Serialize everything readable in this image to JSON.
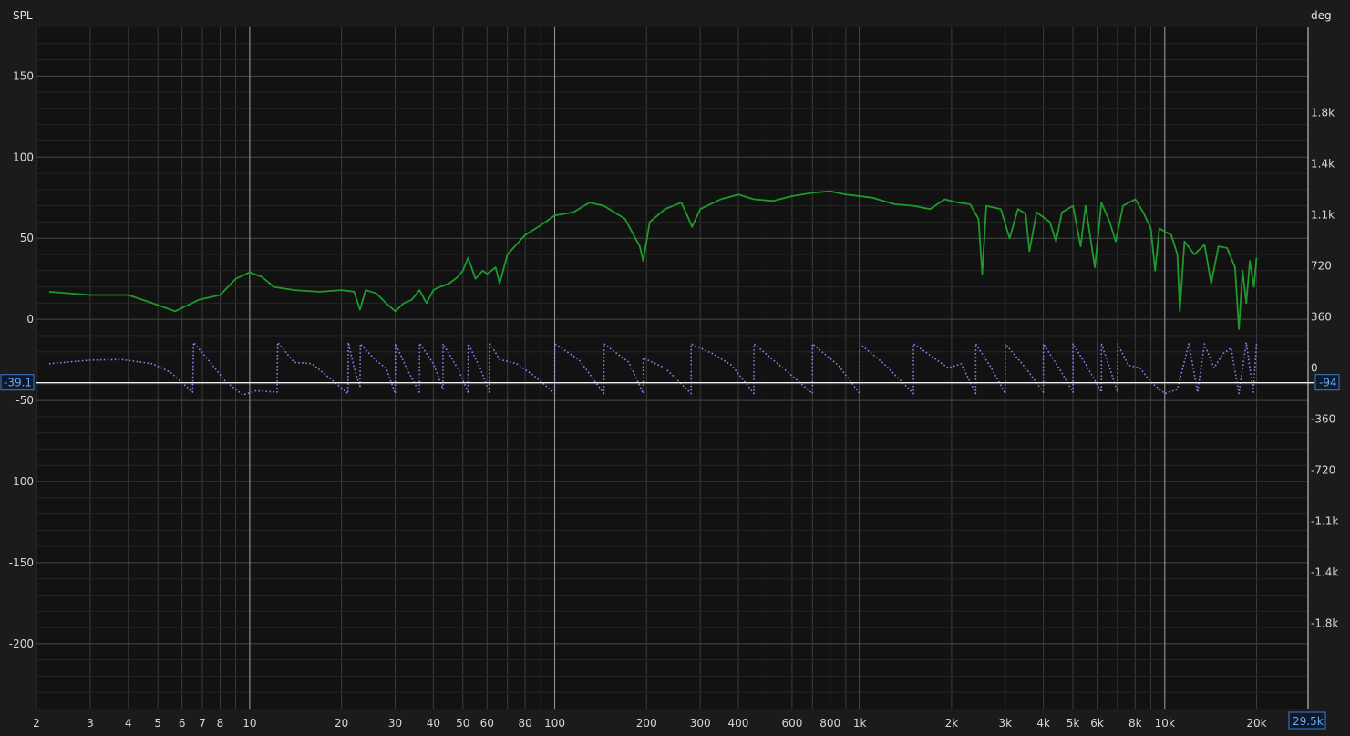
{
  "chart_data": {
    "type": "line",
    "left_axis_title": "SPL",
    "right_axis_title": "deg",
    "x_scale": "log",
    "xlim": [
      2,
      29500
    ],
    "ylim_left": [
      -240,
      180
    ],
    "ylim_right": [
      -2400,
      2400
    ],
    "x_ticks": [
      {
        "v": 2,
        "label": "2"
      },
      {
        "v": 3,
        "label": "3"
      },
      {
        "v": 4,
        "label": "4"
      },
      {
        "v": 5,
        "label": "5"
      },
      {
        "v": 6,
        "label": "6"
      },
      {
        "v": 7,
        "label": "7"
      },
      {
        "v": 8,
        "label": "8"
      },
      {
        "v": 10,
        "label": "10"
      },
      {
        "v": 20,
        "label": "20"
      },
      {
        "v": 30,
        "label": "30"
      },
      {
        "v": 40,
        "label": "40"
      },
      {
        "v": 50,
        "label": "50"
      },
      {
        "v": 60,
        "label": "60"
      },
      {
        "v": 80,
        "label": "80"
      },
      {
        "v": 100,
        "label": "100"
      },
      {
        "v": 200,
        "label": "200"
      },
      {
        "v": 300,
        "label": "300"
      },
      {
        "v": 400,
        "label": "400"
      },
      {
        "v": 600,
        "label": "600"
      },
      {
        "v": 800,
        "label": "800"
      },
      {
        "v": 1000,
        "label": "1k"
      },
      {
        "v": 2000,
        "label": "2k"
      },
      {
        "v": 3000,
        "label": "3k"
      },
      {
        "v": 4000,
        "label": "4k"
      },
      {
        "v": 5000,
        "label": "5k"
      },
      {
        "v": 6000,
        "label": "6k"
      },
      {
        "v": 8000,
        "label": "8k"
      },
      {
        "v": 10000,
        "label": "10k"
      },
      {
        "v": 20000,
        "label": "20k"
      }
    ],
    "y_left_ticks": [
      {
        "v": 150,
        "label": "150"
      },
      {
        "v": 100,
        "label": "100"
      },
      {
        "v": 50,
        "label": "50"
      },
      {
        "v": 0,
        "label": "0"
      },
      {
        "v": -50,
        "label": "-50"
      },
      {
        "v": -100,
        "label": "-100"
      },
      {
        "v": -150,
        "label": "-150"
      },
      {
        "v": -200,
        "label": "-200"
      }
    ],
    "y_right_ticks": [
      {
        "v": 1800,
        "label": "1.8k"
      },
      {
        "v": 1440,
        "label": "1.4k"
      },
      {
        "v": 1080,
        "label": "1.1k"
      },
      {
        "v": 720,
        "label": "720"
      },
      {
        "v": 360,
        "label": "360"
      },
      {
        "v": 0,
        "label": "0"
      },
      {
        "v": -360,
        "label": "-360"
      },
      {
        "v": -720,
        "label": "-720"
      },
      {
        "v": -1080,
        "label": "-1.1k"
      },
      {
        "v": -1440,
        "label": "-1.4k"
      },
      {
        "v": -1800,
        "label": "-1.8k"
      }
    ],
    "cursor": {
      "left_value": "-39.1",
      "right_value": "-94",
      "x_value": "29.5k",
      "spl": -39.1
    },
    "series": [
      {
        "axis": "left",
        "color": "#1e9a2c",
        "style": "solid",
        "points": [
          [
            2.2,
            17
          ],
          [
            3,
            15
          ],
          [
            4,
            15
          ],
          [
            4.8,
            10
          ],
          [
            5.7,
            5
          ],
          [
            6.8,
            12
          ],
          [
            8,
            15
          ],
          [
            9,
            25
          ],
          [
            10,
            29
          ],
          [
            11,
            26
          ],
          [
            12,
            20
          ],
          [
            14,
            18
          ],
          [
            17,
            17
          ],
          [
            20,
            18
          ],
          [
            22,
            17
          ],
          [
            23,
            6
          ],
          [
            24,
            18
          ],
          [
            26,
            16
          ],
          [
            28,
            10
          ],
          [
            30,
            5
          ],
          [
            32,
            10
          ],
          [
            34,
            12
          ],
          [
            36,
            18
          ],
          [
            38,
            10
          ],
          [
            40,
            18
          ],
          [
            42,
            20
          ],
          [
            45,
            22
          ],
          [
            48,
            26
          ],
          [
            50,
            30
          ],
          [
            52,
            38
          ],
          [
            55,
            25
          ],
          [
            58,
            30
          ],
          [
            60,
            28
          ],
          [
            64,
            32
          ],
          [
            66,
            22
          ],
          [
            70,
            40
          ],
          [
            80,
            52
          ],
          [
            90,
            58
          ],
          [
            100,
            64
          ],
          [
            115,
            66
          ],
          [
            130,
            72
          ],
          [
            145,
            70
          ],
          [
            170,
            62
          ],
          [
            190,
            45
          ],
          [
            195,
            36
          ],
          [
            205,
            60
          ],
          [
            230,
            68
          ],
          [
            260,
            72
          ],
          [
            275,
            62
          ],
          [
            282,
            57
          ],
          [
            300,
            68
          ],
          [
            350,
            74
          ],
          [
            400,
            77
          ],
          [
            450,
            74
          ],
          [
            520,
            73
          ],
          [
            600,
            76
          ],
          [
            700,
            78
          ],
          [
            800,
            79
          ],
          [
            900,
            77
          ],
          [
            1000,
            76
          ],
          [
            1100,
            75
          ],
          [
            1300,
            71
          ],
          [
            1500,
            70
          ],
          [
            1700,
            68
          ],
          [
            1900,
            74
          ],
          [
            2100,
            72
          ],
          [
            2300,
            71
          ],
          [
            2450,
            62
          ],
          [
            2520,
            28
          ],
          [
            2600,
            70
          ],
          [
            2900,
            68
          ],
          [
            3100,
            50
          ],
          [
            3300,
            68
          ],
          [
            3500,
            65
          ],
          [
            3600,
            42
          ],
          [
            3800,
            66
          ],
          [
            4200,
            60
          ],
          [
            4400,
            48
          ],
          [
            4600,
            66
          ],
          [
            5000,
            70
          ],
          [
            5300,
            45
          ],
          [
            5500,
            70
          ],
          [
            5900,
            32
          ],
          [
            6200,
            72
          ],
          [
            6600,
            60
          ],
          [
            6900,
            48
          ],
          [
            7300,
            70
          ],
          [
            8000,
            74
          ],
          [
            8500,
            66
          ],
          [
            9000,
            56
          ],
          [
            9300,
            30
          ],
          [
            9600,
            56
          ],
          [
            10500,
            52
          ],
          [
            11000,
            40
          ],
          [
            11200,
            5
          ],
          [
            11600,
            48
          ],
          [
            12500,
            40
          ],
          [
            13500,
            46
          ],
          [
            14200,
            22
          ],
          [
            15000,
            45
          ],
          [
            16000,
            44
          ],
          [
            17000,
            32
          ],
          [
            17500,
            -6
          ],
          [
            18000,
            30
          ],
          [
            18500,
            10
          ],
          [
            19000,
            36
          ],
          [
            19600,
            20
          ],
          [
            20000,
            38
          ]
        ]
      },
      {
        "axis": "right",
        "color": "#8f7cf0",
        "style": "dotted",
        "points": [
          [
            2.2,
            30
          ],
          [
            3,
            55
          ],
          [
            3.8,
            60
          ],
          [
            4.8,
            30
          ],
          [
            5.5,
            -30
          ],
          [
            6.5,
            -170
          ],
          [
            6.55,
            180
          ],
          [
            7.3,
            60
          ],
          [
            8.3,
            -90
          ],
          [
            9.5,
            -190
          ],
          [
            10.5,
            -160
          ],
          [
            12.3,
            -170
          ],
          [
            12.35,
            180
          ],
          [
            14,
            40
          ],
          [
            16,
            30
          ],
          [
            19,
            -100
          ],
          [
            21,
            -180
          ],
          [
            21.05,
            180
          ],
          [
            22,
            0
          ],
          [
            23,
            -130
          ],
          [
            23.05,
            170
          ],
          [
            26,
            50
          ],
          [
            28,
            0
          ],
          [
            30,
            -180
          ],
          [
            30.05,
            170
          ],
          [
            33,
            -20
          ],
          [
            36,
            -170
          ],
          [
            36.05,
            175
          ],
          [
            40,
            30
          ],
          [
            43,
            -150
          ],
          [
            43.05,
            170
          ],
          [
            48,
            0
          ],
          [
            52,
            -170
          ],
          [
            52.05,
            170
          ],
          [
            57,
            0
          ],
          [
            61,
            -170
          ],
          [
            61.05,
            180
          ],
          [
            66,
            60
          ],
          [
            75,
            30
          ],
          [
            85,
            -50
          ],
          [
            100,
            -180
          ],
          [
            100.05,
            170
          ],
          [
            120,
            60
          ],
          [
            145,
            -180
          ],
          [
            145.05,
            170
          ],
          [
            175,
            40
          ],
          [
            195,
            -180
          ],
          [
            195.05,
            70
          ],
          [
            230,
            0
          ],
          [
            280,
            -180
          ],
          [
            280.05,
            170
          ],
          [
            330,
            100
          ],
          [
            380,
            20
          ],
          [
            450,
            -180
          ],
          [
            450.05,
            170
          ],
          [
            560,
            0
          ],
          [
            700,
            -180
          ],
          [
            700.05,
            170
          ],
          [
            850,
            20
          ],
          [
            1000,
            -180
          ],
          [
            1000.05,
            170
          ],
          [
            1200,
            30
          ],
          [
            1500,
            -180
          ],
          [
            1500.05,
            170
          ],
          [
            1700,
            90
          ],
          [
            1950,
            0
          ],
          [
            2150,
            30
          ],
          [
            2400,
            -180
          ],
          [
            2400.05,
            170
          ],
          [
            2700,
            0
          ],
          [
            3000,
            -180
          ],
          [
            3000.05,
            170
          ],
          [
            3500,
            0
          ],
          [
            4000,
            -170
          ],
          [
            4000.05,
            170
          ],
          [
            4500,
            0
          ],
          [
            5000,
            -170
          ],
          [
            5000.05,
            170
          ],
          [
            5600,
            0
          ],
          [
            6200,
            -170
          ],
          [
            6200.05,
            170
          ],
          [
            6600,
            0
          ],
          [
            7000,
            -170
          ],
          [
            7000.05,
            170
          ],
          [
            7600,
            20
          ],
          [
            8300,
            0
          ],
          [
            9000,
            -100
          ],
          [
            10000,
            -180
          ],
          [
            11000,
            -150
          ],
          [
            12000,
            170
          ],
          [
            12800,
            -170
          ],
          [
            13500,
            170
          ],
          [
            14500,
            0
          ],
          [
            15500,
            100
          ],
          [
            16500,
            140
          ],
          [
            17500,
            -180
          ],
          [
            18500,
            180
          ],
          [
            19500,
            -170
          ],
          [
            20000,
            170
          ]
        ]
      }
    ]
  }
}
